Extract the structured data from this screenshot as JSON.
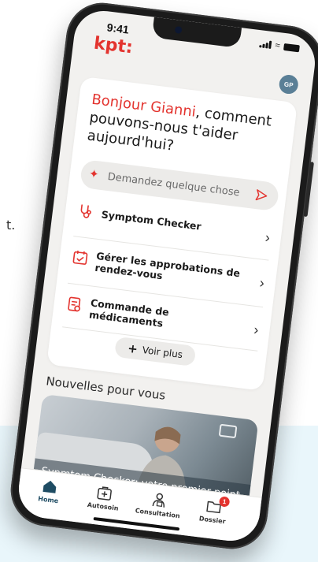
{
  "background": {
    "fragment_text": "t."
  },
  "status_bar": {
    "time": "9:41"
  },
  "header": {
    "logo": "kpt:",
    "avatar_initials": "GP"
  },
  "greeting": {
    "name_part": "Bonjour Gianni",
    "rest": ", comment pouvons-nous t'aider aujourd'hui?"
  },
  "ask": {
    "placeholder": "Demandez quelque chose"
  },
  "menu": {
    "items": [
      {
        "label": "Symptom Checker",
        "icon": "stethoscope-icon"
      },
      {
        "label": "Gérer les approbations de rendez-vous",
        "icon": "calendar-check-icon"
      },
      {
        "label": "Commande de médicaments",
        "icon": "prescription-icon"
      }
    ]
  },
  "more": {
    "label": "Voir plus"
  },
  "news": {
    "section_title": "Nouvelles pour vous",
    "card_caption": "Sypmtom Checker: votre premier point"
  },
  "tabbar": {
    "items": [
      {
        "label": "Home",
        "icon": "home-icon",
        "active": true
      },
      {
        "label": "Autosoin",
        "icon": "first-aid-icon",
        "active": false
      },
      {
        "label": "Consultation",
        "icon": "doctor-icon",
        "active": false
      },
      {
        "label": "Dossier",
        "icon": "folder-icon",
        "active": false,
        "badge": "1"
      }
    ]
  },
  "colors": {
    "brand_red": "#e3342f",
    "nav_blue": "#1f4c63"
  }
}
